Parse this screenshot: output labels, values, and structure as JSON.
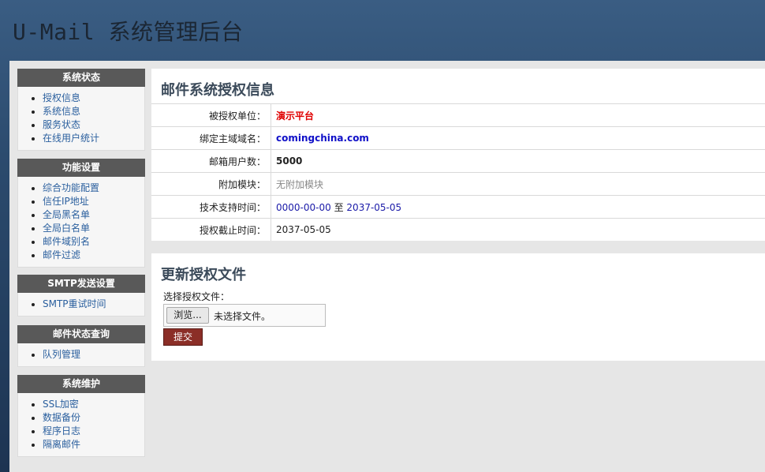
{
  "header": {
    "title": "U-Mail 系统管理后台"
  },
  "sidebar": [
    {
      "title": "系统状态",
      "items": [
        "授权信息",
        "系统信息",
        "服务状态",
        "在线用户统计"
      ]
    },
    {
      "title": "功能设置",
      "items": [
        "综合功能配置",
        "信任IP地址",
        "全局黑名单",
        "全局白名单",
        "邮件域别名",
        "邮件过滤"
      ]
    },
    {
      "title": "SMTP发送设置",
      "items": [
        "SMTP重试时间"
      ]
    },
    {
      "title": "邮件状态查询",
      "items": [
        "队列管理"
      ]
    },
    {
      "title": "系统维护",
      "items": [
        "SSL加密",
        "数据备份",
        "程序日志",
        "隔离邮件"
      ]
    }
  ],
  "license": {
    "title": "邮件系统授权信息",
    "rows": [
      {
        "label": "被授权单位：",
        "value": "演示平台"
      },
      {
        "label": "绑定主域域名：",
        "value": "comingchina.com"
      },
      {
        "label": "邮箱用户数：",
        "value": "5000"
      },
      {
        "label": "附加模块：",
        "value": "无附加模块"
      },
      {
        "label": "技术支持时间：",
        "from": "0000-00-00",
        "sep": "至",
        "to": "2037-05-05"
      },
      {
        "label": "授权截止时间：",
        "value": "2037-05-05"
      }
    ]
  },
  "update": {
    "title": "更新授权文件",
    "file_label": "选择授权文件：",
    "browse_label": "浏览...",
    "no_file_text": "未选择文件。",
    "submit_label": "提交"
  },
  "colors": {
    "accent_red": "#e00000",
    "link_blue": "#2a5f9e",
    "button_red": "#8b2e27"
  }
}
